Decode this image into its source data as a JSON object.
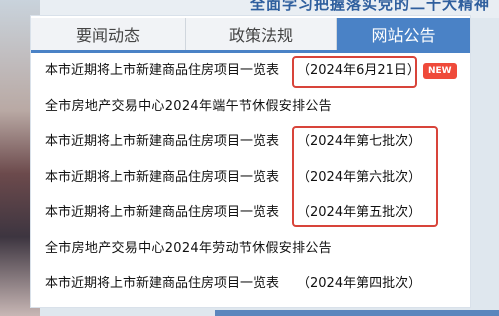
{
  "banner": "全面学习把握落实党的二十大精神",
  "tabs": [
    {
      "label": "要闻动态",
      "active": false
    },
    {
      "label": "政策法规",
      "active": false
    },
    {
      "label": "网站公告",
      "active": true
    }
  ],
  "badge_new": "NEW",
  "items": [
    {
      "title": "本市近期将上市新建商品住房项目一览表",
      "suffix": "（2024年6月21日）",
      "is_new": true
    },
    {
      "title": "全市房地产交易中心2024年端午节休假安排公告",
      "suffix": ""
    },
    {
      "title": "本市近期将上市新建商品住房项目一览表",
      "suffix": "（2024年第七批次）"
    },
    {
      "title": "本市近期将上市新建商品住房项目一览表",
      "suffix": "（2024年第六批次）"
    },
    {
      "title": "本市近期将上市新建商品住房项目一览表",
      "suffix": "（2024年第五批次）"
    },
    {
      "title": "全市房地产交易中心2024年劳动节休假安排公告",
      "suffix": ""
    },
    {
      "title": "本市近期将上市新建商品住房项目一览表",
      "suffix": "（2024年第四批次）"
    }
  ],
  "colors": {
    "accent": "#4a82c6",
    "highlight": "#d8443a",
    "badge": "#ef4a3a"
  }
}
